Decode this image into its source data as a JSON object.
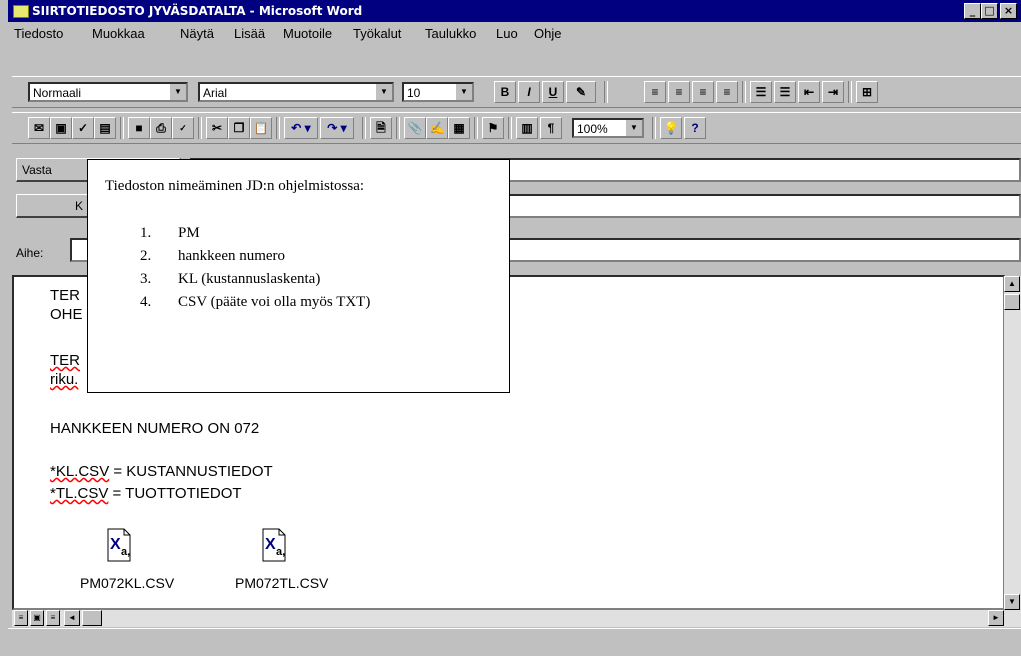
{
  "window": {
    "title": "SIIRTOTIEDOSTO JYVÄSDATALTA - Microsoft Word",
    "minimize": "_",
    "restore": "□",
    "close": "×"
  },
  "menu": [
    "Tiedosto",
    "Muokkaa",
    "Näytä",
    "Lisää",
    "Muotoile",
    "Työkalut",
    "Taulukko",
    "Luo",
    "Ohje"
  ],
  "formatting": {
    "style": "Normaali",
    "font": "Arial",
    "size": "10",
    "bold": "B",
    "italic": "I",
    "underline": "U"
  },
  "standard": {
    "zoom": "100%",
    "pilcrow": "¶",
    "help": "?"
  },
  "header": {
    "to_label": "Vasta",
    "cc_label": "K",
    "subject_label": "Aihe:"
  },
  "document": {
    "line1": "TER",
    "line2": "OHE",
    "line3": "TER",
    "line4": "riku.",
    "project": "HANKKEEN NUMERO ON 072",
    "kl_name": "*KL.CSV",
    "kl_desc": " =  KUSTANNUSTIEDOT",
    "tl_name": "*TL.CSV",
    "tl_desc": " = TUOTTOTIEDOT",
    "attachments": [
      {
        "name": "PM072KL.CSV"
      },
      {
        "name": "PM072TL.CSV"
      }
    ]
  },
  "popup": {
    "title": "Tiedoston nimeäminen JD:n ohjelmistossa:",
    "items": [
      {
        "num": "1.",
        "text": "PM"
      },
      {
        "num": "2.",
        "text": "hankkeen numero"
      },
      {
        "num": "3.",
        "text": "KL (kustannuslaskenta)"
      },
      {
        "num": "4.",
        "text": "CSV (pääte voi olla myös TXT)"
      }
    ]
  },
  "colors": {
    "titlebar": "#000080",
    "chrome": "#c0c0c0",
    "spellcheck": "#ff0000"
  }
}
